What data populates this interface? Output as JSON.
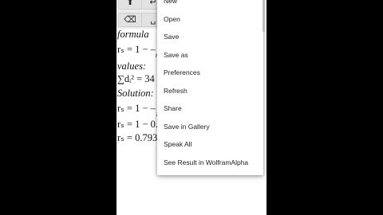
{
  "keypad": {
    "keys": [
      {
        "name": "arrow-up-key",
        "glyph": "⬆"
      },
      {
        "name": "enter-key",
        "glyph": "↵"
      },
      {
        "name": "backspace-key",
        "glyph": "⌫"
      },
      {
        "name": "space-key",
        "glyph": "␣"
      }
    ]
  },
  "document": {
    "lines": [
      {
        "label": "formula",
        "math": ""
      },
      {
        "label": "r",
        "math": "rₛ = 1 − –"
      },
      {
        "label": "values:",
        "math": ""
      },
      {
        "label": "sum",
        "math": "∑dᵢ² = 34"
      },
      {
        "label": "Solution:",
        "math": ""
      },
      {
        "label": "r1",
        "math": "rₛ = 1 − –"
      },
      {
        "label": "r2",
        "math": "rₛ = 1 − 0."
      },
      {
        "label": "r3",
        "math": "rₛ = 0.793"
      }
    ],
    "denominator_fragment_1": "n",
    "denominator_fragment_2": "1"
  },
  "menu": {
    "items": [
      "New",
      "Open",
      "Save",
      "Save as",
      "Preferences",
      "Refresh",
      "Share",
      "Save in Gallery",
      "Speak All",
      "See Result in WolframAlpha"
    ]
  }
}
